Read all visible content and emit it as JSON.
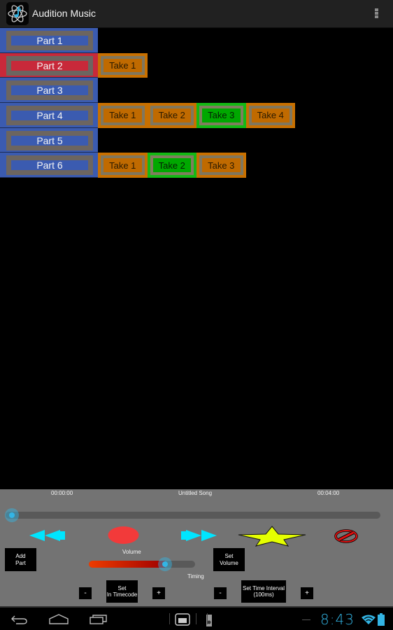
{
  "app": {
    "title": "Audition Music",
    "icon": "atom-music-note-icon"
  },
  "actionbar": {
    "overflow_icon": "overflow-menu-icon"
  },
  "parts": [
    {
      "label": "Part 1",
      "selected": false,
      "takes": []
    },
    {
      "label": "Part 2",
      "selected": true,
      "takes": [
        {
          "label": "Take 1",
          "active": false
        }
      ]
    },
    {
      "label": "Part 3",
      "selected": false,
      "takes": []
    },
    {
      "label": "Part 4",
      "selected": false,
      "takes": [
        {
          "label": "Take 1",
          "active": false
        },
        {
          "label": "Take 2",
          "active": false
        },
        {
          "label": "Take 3",
          "active": true
        },
        {
          "label": "Take 4",
          "active": false
        }
      ]
    },
    {
      "label": "Part 5",
      "selected": false,
      "takes": []
    },
    {
      "label": "Part 6",
      "selected": false,
      "takes": [
        {
          "label": "Take 1",
          "active": false
        },
        {
          "label": "Take 2",
          "active": true
        },
        {
          "label": "Take 3",
          "active": false
        }
      ]
    }
  ],
  "colors": {
    "part": "#3b5bb0",
    "part_selected": "#c8293a",
    "take": "#c06a00",
    "take_active": "#00a800",
    "accent": "#33b5e5",
    "record": "#f23a3a",
    "transport": "#00e5ff",
    "star": "#e5ff00"
  },
  "player": {
    "start_time": "00:00:00",
    "song_title": "Untitled Song",
    "end_time": "00:04:00",
    "position_fraction": 0.0
  },
  "transport": {
    "rewind_icon": "rewind-icon",
    "record_icon": "record-icon",
    "fast_forward_icon": "fast-forward-icon",
    "star_icon": "star-icon",
    "cancel_icon": "no-entry-icon"
  },
  "controls": {
    "add_part": "Add\nPart",
    "volume_label": "Volume",
    "volume_fraction": 0.72,
    "set_volume": "Set\nVolume",
    "timing_label": "Timing",
    "minus": "-",
    "plus": "+",
    "set_in_timecode": "Set\nIn Timecode",
    "set_time_interval": "Set Time Interval\n(100ms)"
  },
  "navbar": {
    "back_icon": "back-icon",
    "home_icon": "home-icon",
    "recents_icon": "recent-apps-icon",
    "screenshot_icon": "screenshot-icon",
    "usb_icon": "usb-debug-icon",
    "clock": "8:43",
    "wifi_icon": "wifi-icon",
    "battery_icon": "battery-icon"
  }
}
